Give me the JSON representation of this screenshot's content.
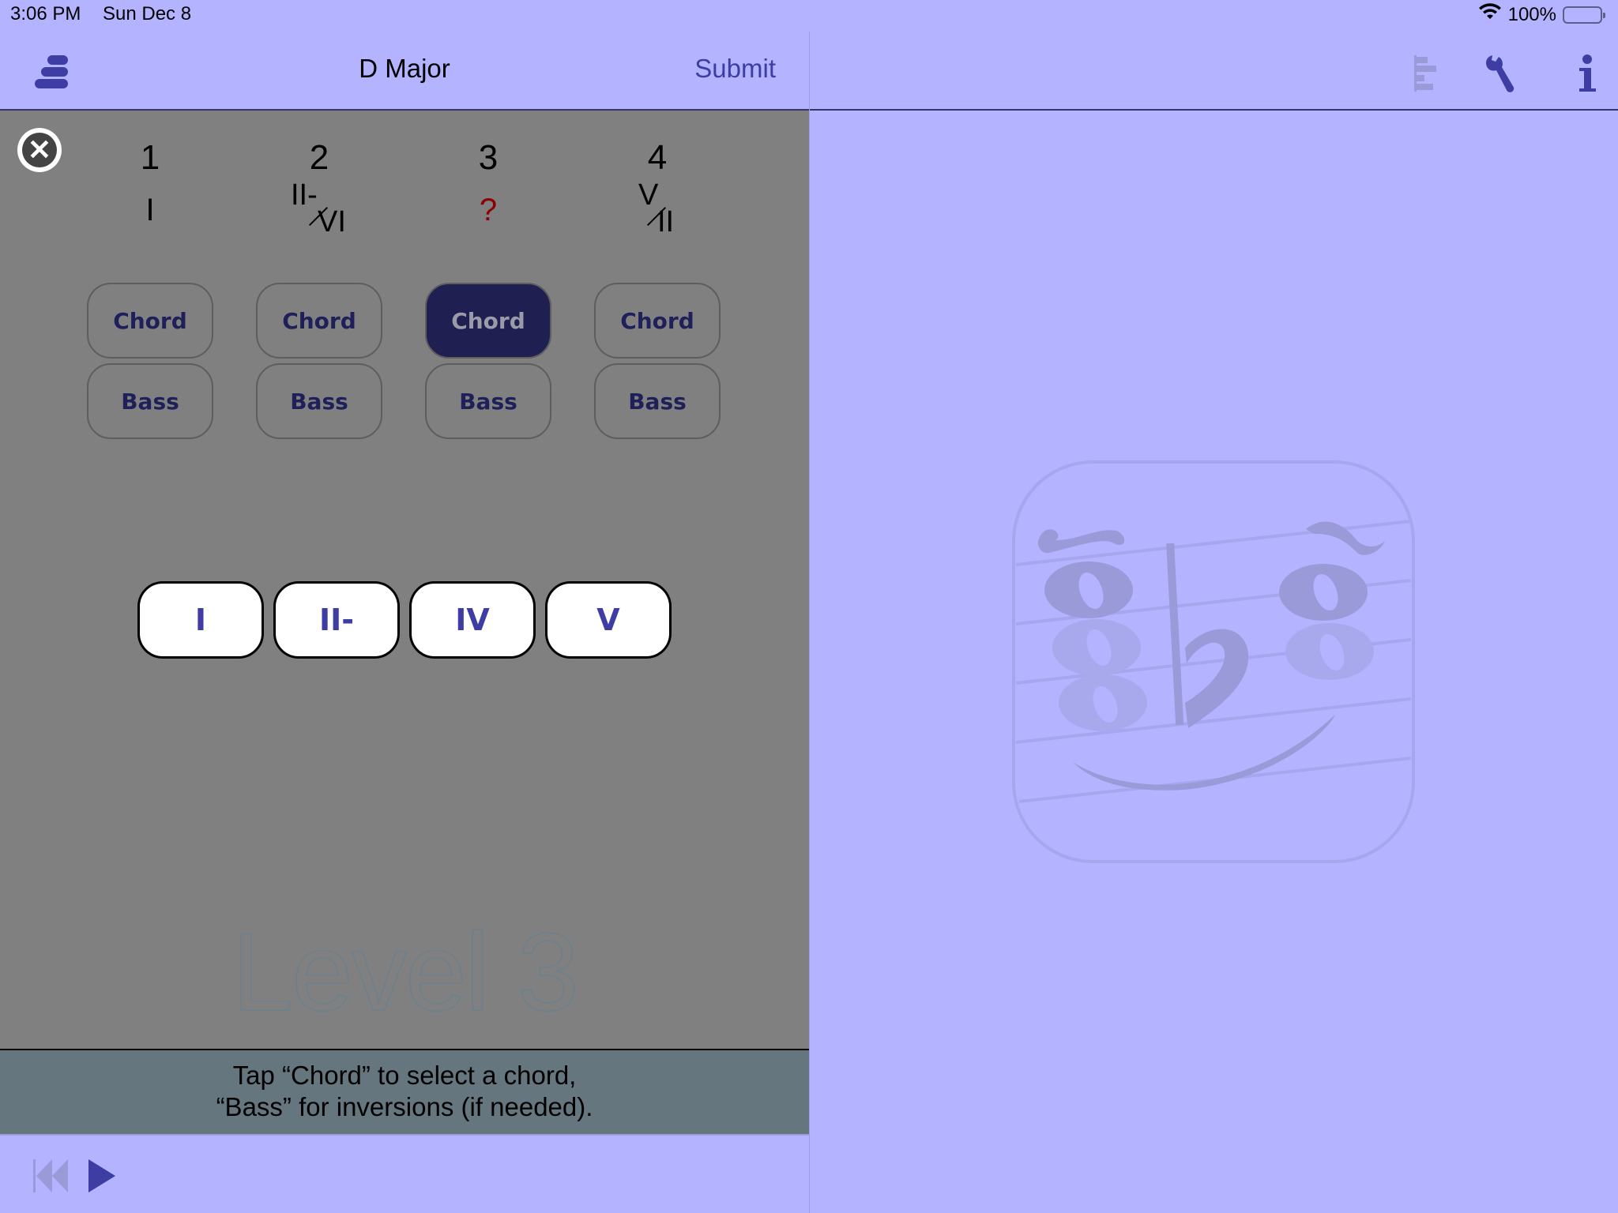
{
  "status_bar": {
    "time": "3:06 PM",
    "date": "Sun Dec 8",
    "battery_text": "100%",
    "icons": [
      "wifi-icon",
      "battery-icon"
    ]
  },
  "left_nav": {
    "menu_icon": "stack-menu-icon",
    "title": "D Major",
    "submit_label": "Submit"
  },
  "right_nav": {
    "icons": [
      "bar-chart-icon",
      "wrench-icon",
      "info-icon"
    ]
  },
  "exercise": {
    "close_icon": "close-circle-icon",
    "columns": [
      {
        "number": "1",
        "chord": {
          "type": "single",
          "text": "I"
        },
        "chord_button": "Chord",
        "bass_button": "Bass",
        "active": false
      },
      {
        "number": "2",
        "chord": {
          "type": "slash",
          "numerator": "II-",
          "denominator": "VI"
        },
        "chord_button": "Chord",
        "bass_button": "Bass",
        "active": false
      },
      {
        "number": "3",
        "chord": {
          "type": "unknown",
          "text": "?"
        },
        "chord_button": "Chord",
        "bass_button": "Bass",
        "active": true
      },
      {
        "number": "4",
        "chord": {
          "type": "slash",
          "numerator": "V",
          "denominator": "II"
        },
        "chord_button": "Chord",
        "bass_button": "Bass",
        "active": false
      }
    ],
    "chord_choices": [
      "I",
      "II-",
      "IV",
      "V"
    ],
    "level_watermark": "Level 3"
  },
  "hint": {
    "line1": "Tap “Chord” to select a chord,",
    "line2": "“Bass” for inversions (if needed)."
  },
  "playback": {
    "icons": [
      "rewind-to-start-icon",
      "play-icon"
    ]
  },
  "colors": {
    "background": "#b3b3ff",
    "accent": "#3d3da3",
    "workarea": "#808080",
    "active_button": "#1f1f52",
    "unknown_chord": "#8b0000",
    "hint_bar": "#66767e"
  }
}
